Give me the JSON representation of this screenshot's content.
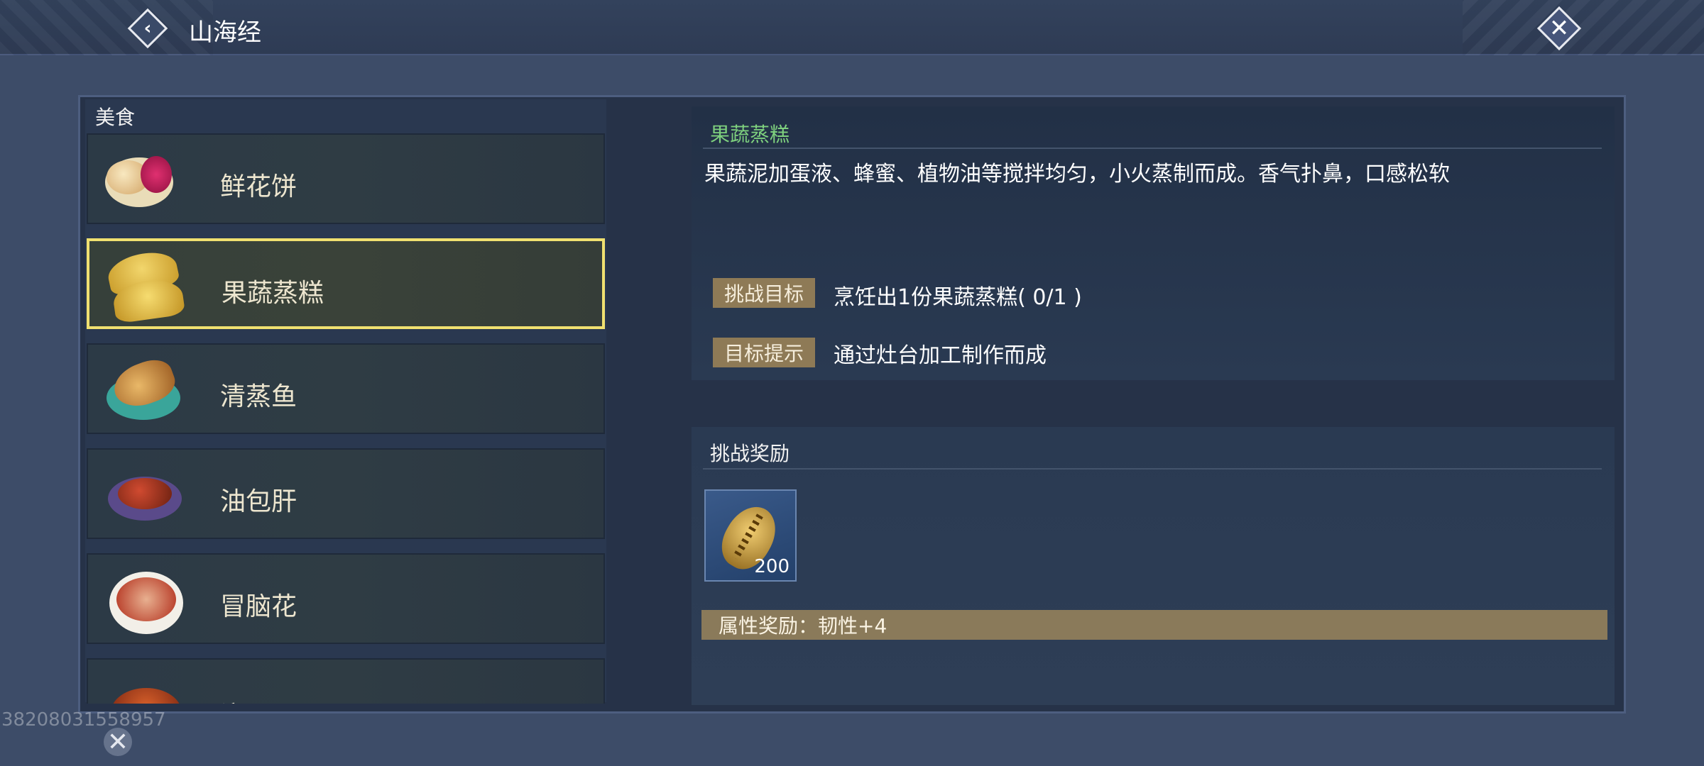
{
  "header": {
    "title": "山海经"
  },
  "category": {
    "label": "美食"
  },
  "food_list": [
    {
      "name": "鲜花饼",
      "icon": "flower-cake-icon",
      "selected": false
    },
    {
      "name": "果蔬蒸糕",
      "icon": "steamed-cake-icon",
      "selected": true
    },
    {
      "name": "清蒸鱼",
      "icon": "steamed-fish-icon",
      "selected": false
    },
    {
      "name": "油包肝",
      "icon": "oil-liver-icon",
      "selected": false
    },
    {
      "name": "冒脑花",
      "icon": "brain-soup-icon",
      "selected": false
    },
    {
      "name": "溜肥肠",
      "icon": "stir-fried-intestine-icon",
      "selected": false
    }
  ],
  "detail": {
    "title": "果蔬蒸糕",
    "description": "果蔬泥加蛋液、蜂蜜、植物油等搅拌均匀，小火蒸制而成。香气扑鼻，口感松软",
    "challenge_goal_label": "挑战目标",
    "challenge_goal_value": "烹饪出1份果蔬蒸糕( 0/1 )",
    "goal_hint_label": "目标提示",
    "goal_hint_value": "通过灶台加工制作而成"
  },
  "reward": {
    "title": "挑战奖励",
    "item_icon": "seed-icon",
    "item_qty": "200",
    "attribute": "属性奖励：韧性+4"
  },
  "footer": {
    "uid": "38208031558957"
  },
  "colors": {
    "accent_green": "#7ed07e",
    "selected_border": "#f0e070",
    "tag_bg": "#8e7a56"
  }
}
